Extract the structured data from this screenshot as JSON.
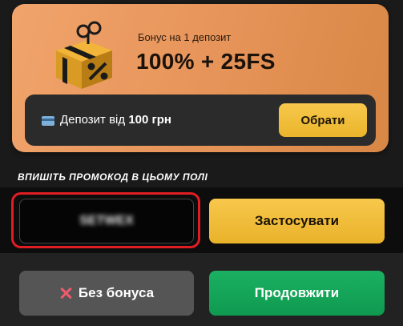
{
  "bonus_card": {
    "subtitle": "Бонус на 1 депозит",
    "title": "100% + 25FS",
    "deposit_prefix": "Депозит від",
    "deposit_amount": "100 грн",
    "choose_label": "Обрати",
    "gift_icon": "gift-percent-icon",
    "card_icon": "credit-card-icon"
  },
  "promo": {
    "label": "ВПИШІТЬ ПРОМОКОД В ЦЬОМУ ПОЛІ",
    "value": "SETWEX",
    "apply_label": "Застосувати",
    "highlight_color": "#e11d24"
  },
  "footer": {
    "no_bonus_label": "Без бонуса",
    "no_bonus_icon": "close-icon",
    "continue_label": "Продовжити"
  },
  "colors": {
    "accent_yellow": "#f8c84c",
    "accent_green": "#1bb061",
    "card_orange": "#e8965c"
  }
}
